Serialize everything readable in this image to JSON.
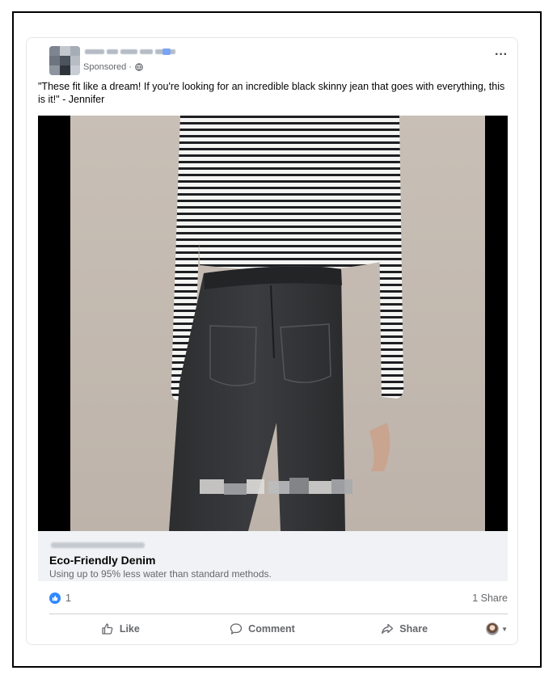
{
  "post": {
    "sponsored_label": "Sponsored ·",
    "text": "\"These fit like a dream! If you're looking for an incredible black skinny jean that goes with everything, this is it!\" - Jennifer"
  },
  "link_preview": {
    "headline": "Eco-Friendly Denim",
    "description": "Using up to 95% less water than standard methods."
  },
  "engagement": {
    "reaction_count": "1",
    "shares": "1 Share"
  },
  "actions": {
    "like": "Like",
    "comment": "Comment",
    "share": "Share"
  },
  "icons": [
    "globe-icon",
    "more-options-icon",
    "like-reaction-icon",
    "thumbs-up-icon",
    "comment-icon",
    "share-icon",
    "audience-avatar-icon",
    "caret-down-icon"
  ],
  "colors": {
    "like_blue": "#2d88ff",
    "secondary_text": "#65676b",
    "preview_bg": "#f0f2f5"
  }
}
